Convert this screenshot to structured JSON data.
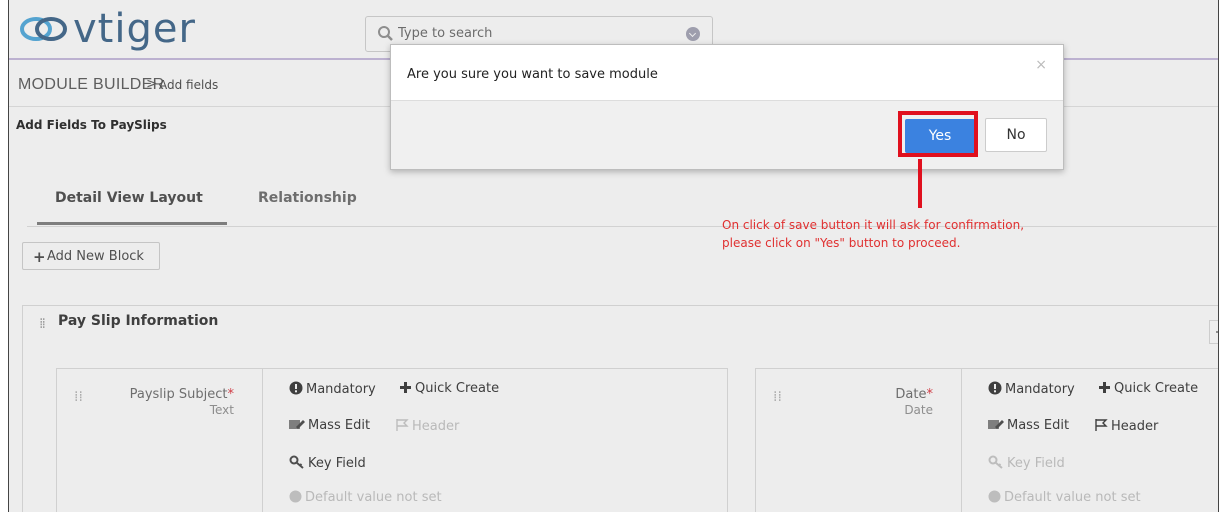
{
  "app": {
    "logo_text": "vtiger"
  },
  "search": {
    "placeholder": "Type to search"
  },
  "breadcrumb": {
    "module": "MODULE BUILDER",
    "separator": ">",
    "page": "Add fields"
  },
  "page": {
    "title": "Add Fields To PaySlips"
  },
  "tabs": [
    {
      "label": "Detail View Layout",
      "active": true
    },
    {
      "label": "Relationship",
      "active": false
    }
  ],
  "add_block": {
    "label": "Add New Block"
  },
  "block": {
    "title": "Pay Slip Information",
    "fields": [
      {
        "label": "Payslip Subject",
        "required_mark": "*",
        "type": "Text",
        "mandatory": "Mandatory",
        "quick_create": "Quick Create",
        "mass_edit": "Mass Edit",
        "header": "Header",
        "key_field": "Key Field",
        "default_value": "Default value not set"
      },
      {
        "label": "Date",
        "required_mark": "*",
        "type": "Date",
        "mandatory": "Mandatory",
        "quick_create": "Quick Create",
        "mass_edit": "Mass Edit",
        "header": "Header",
        "key_field": "Key Field",
        "default_value": "Default value not set"
      }
    ]
  },
  "modal": {
    "message": "Are you sure you want to save module",
    "close": "×",
    "yes_label": "Yes",
    "no_label": "No"
  },
  "annotation": {
    "line1": "On click of save button it will ask for confirmation,",
    "line2": "please click on \"Yes\" button to proceed."
  },
  "colors": {
    "primary_button": "#3b82e0",
    "highlight": "#e0101e",
    "annotation_text": "#e03030",
    "required": "#e0404a",
    "logo": "#4a6f93"
  }
}
